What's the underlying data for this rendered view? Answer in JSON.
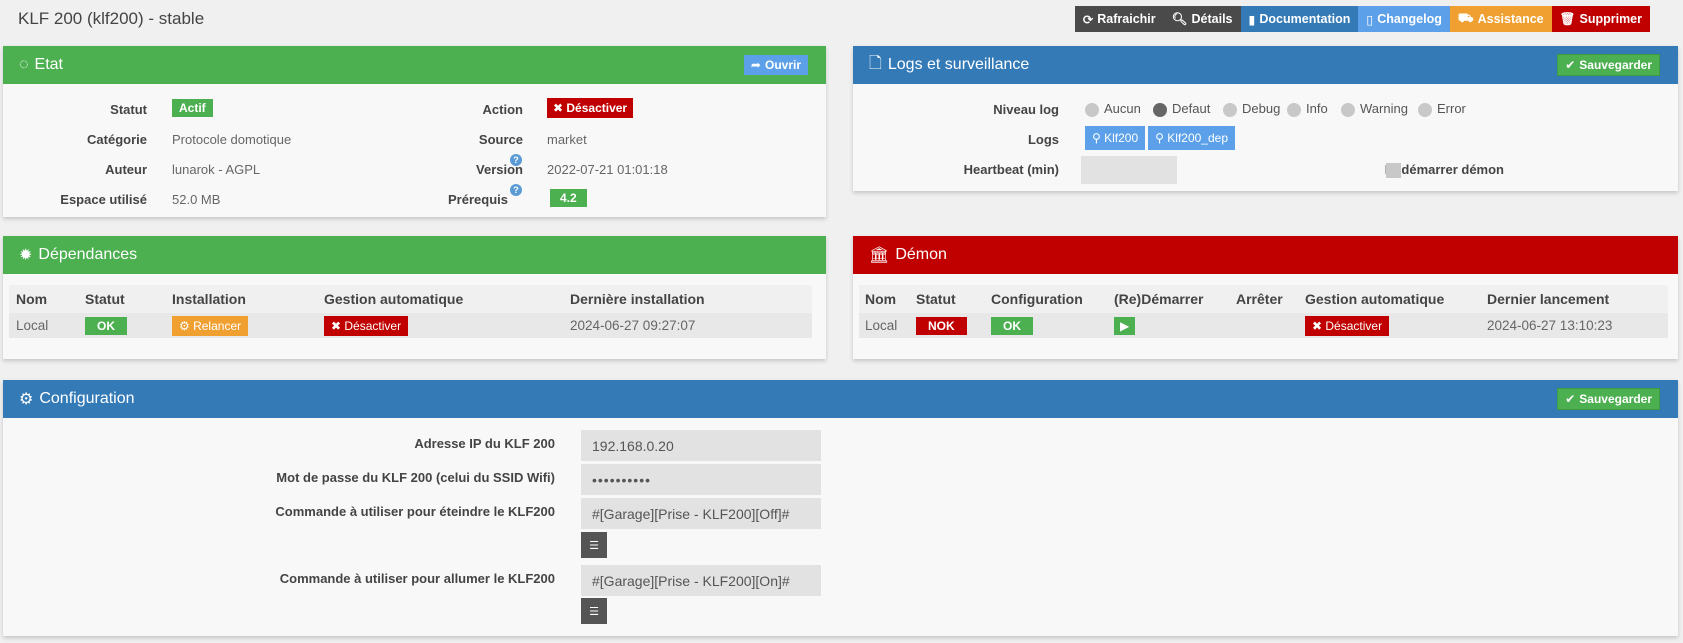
{
  "page": {
    "title": "KLF 200 (klf200) - stable"
  },
  "toolbar": {
    "refresh": "Rafraichir",
    "details": "Détails",
    "documentation": "Documentation",
    "changelog": "Changelog",
    "assistance": "Assistance",
    "delete": "Supprimer"
  },
  "etat": {
    "title": "Etat",
    "open_btn": "Ouvrir",
    "rows": {
      "statut_label": "Statut",
      "statut_value": "Actif",
      "categorie_label": "Catégorie",
      "categorie_value": "Protocole domotique",
      "auteur_label": "Auteur",
      "auteur_value": "lunarok - AGPL",
      "espace_label": "Espace utilisé",
      "espace_value": "52.0 MB",
      "action_label": "Action",
      "action_value": "Désactiver",
      "source_label": "Source",
      "source_value": "market",
      "version_label": "Version",
      "version_value": "2022-07-21 01:01:18",
      "prerequis_label": "Prérequis",
      "prerequis_value": "4.2"
    }
  },
  "logs": {
    "title": "Logs et surveillance",
    "save_btn": "Sauvegarder",
    "niveau_label": "Niveau log",
    "levels": [
      "Aucun",
      "Defaut",
      "Debug",
      "Info",
      "Warning",
      "Error"
    ],
    "selected_level": "Defaut",
    "logs_label": "Logs",
    "log_buttons": [
      "Klf200",
      "Klf200_dep"
    ],
    "heartbeat_label": "Heartbeat (min)",
    "heartbeat_value": "",
    "restart_label": "Redémarrer démon"
  },
  "deps": {
    "title": "Dépendances",
    "headers": [
      "Nom",
      "Statut",
      "Installation",
      "Gestion automatique",
      "Dernière installation"
    ],
    "row": {
      "nom": "Local",
      "statut": "OK",
      "installation": "Relancer",
      "gestion": "Désactiver",
      "derniere": "2024-06-27 09:27:07"
    }
  },
  "demon": {
    "title": "Démon",
    "headers": [
      "Nom",
      "Statut",
      "Configuration",
      "(Re)Démarrer",
      "Arrêter",
      "Gestion automatique",
      "Dernier lancement"
    ],
    "row": {
      "nom": "Local",
      "statut": "NOK",
      "config": "OK",
      "gestion": "Désactiver",
      "dernier": "2024-06-27 13:10:23"
    }
  },
  "config": {
    "title": "Configuration",
    "save_btn": "Sauvegarder",
    "ip_label": "Adresse IP du KLF 200",
    "ip_value": "192.168.0.20",
    "pwd_label": "Mot de passe du KLF 200 (celui du SSID Wifi)",
    "pwd_value": "••••••••••",
    "off_label": "Commande à utiliser pour éteindre le KLF200",
    "off_value": "#[Garage][Prise - KLF200][Off]#",
    "on_label": "Commande à utiliser pour allumer le KLF200",
    "on_value": "#[Garage][Prise - KLF200][On]#"
  },
  "colors": {
    "green": "#4caf50",
    "blue": "#337ab7",
    "red": "#c00000",
    "orange": "#f0a030",
    "light_blue": "#5ba0e8",
    "dark": "#4a4a4a"
  }
}
